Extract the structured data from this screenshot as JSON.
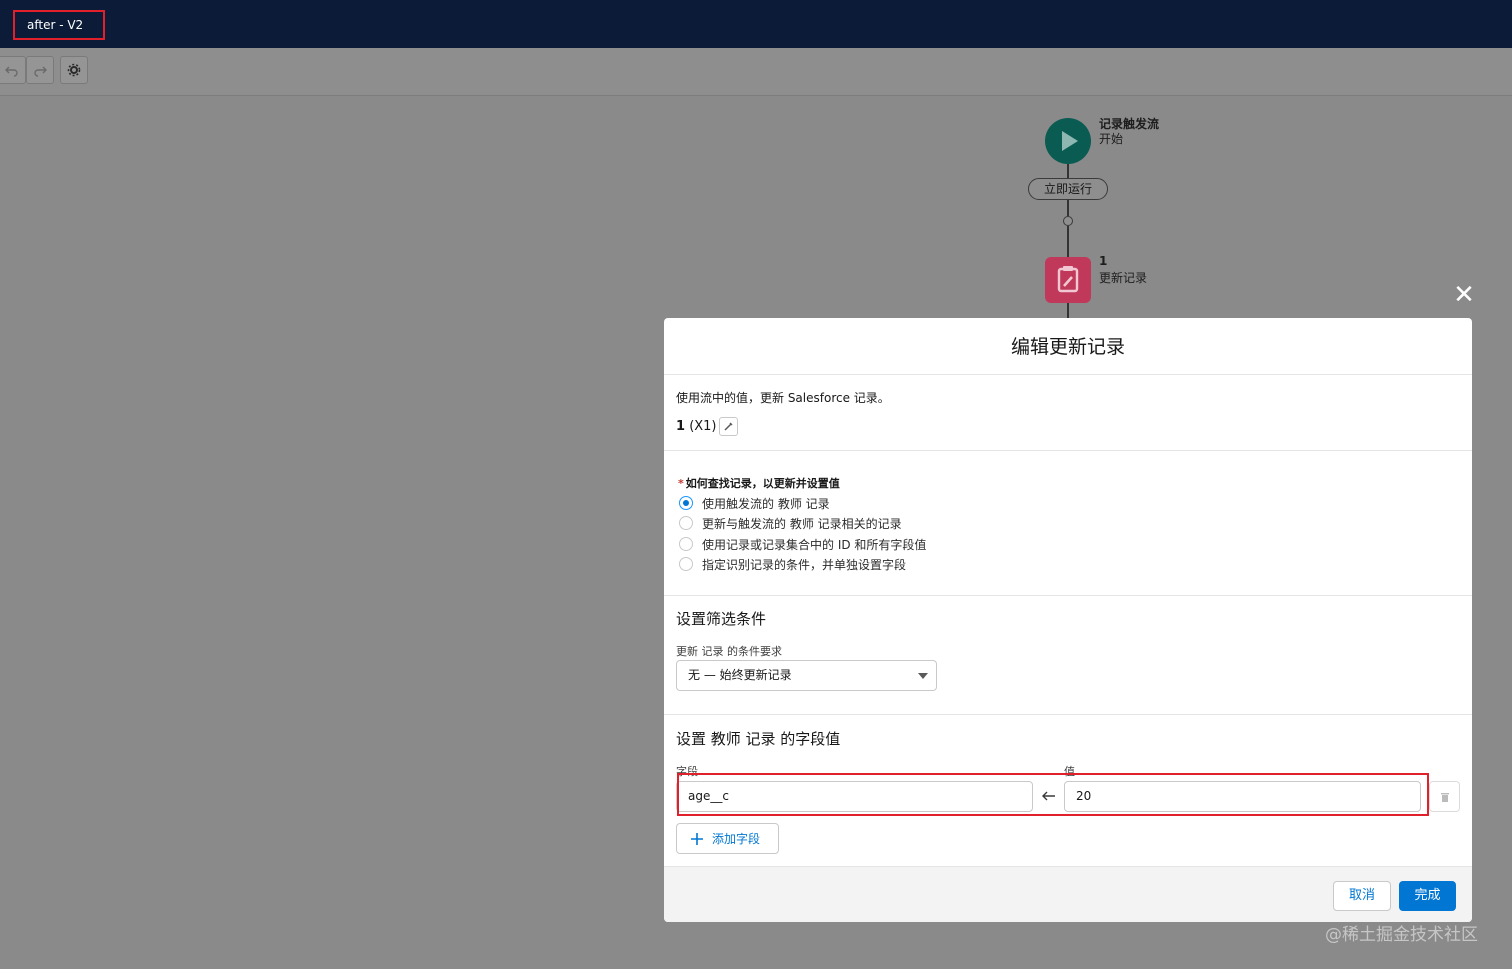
{
  "header": {
    "flow_title": "after - V2"
  },
  "canvas": {
    "start_node": {
      "title": "记录触发流",
      "subtitle": "开始"
    },
    "run_pill": "立即运行",
    "update_node": {
      "title": "1",
      "subtitle": "更新记录"
    }
  },
  "modal": {
    "title": "编辑更新记录",
    "description": "使用流中的值，更新 Salesforce 记录。",
    "record_name_bold": "1",
    "record_name_api": "(X1)",
    "find_records": {
      "label": "如何查找记录，以更新并设置值",
      "options": [
        "使用触发流的 教师 记录",
        "更新与触发流的 教师 记录相关的记录",
        "使用记录或记录集合中的 ID 和所有字段值",
        "指定识别记录的条件，并单独设置字段"
      ],
      "selected_index": 0
    },
    "filter": {
      "section_title": "设置筛选条件",
      "condition_label": "更新 记录 的条件要求",
      "condition_value": "无 — 始终更新记录"
    },
    "field_values": {
      "section_title": "设置 教师 记录 的字段值",
      "field_col_label": "字段",
      "value_col_label": "值",
      "rows": [
        {
          "field": "age__c",
          "value": "20"
        }
      ],
      "add_button": "添加字段"
    },
    "footer": {
      "cancel": "取消",
      "done": "完成"
    }
  },
  "watermark": "@稀土掘金技术社区"
}
